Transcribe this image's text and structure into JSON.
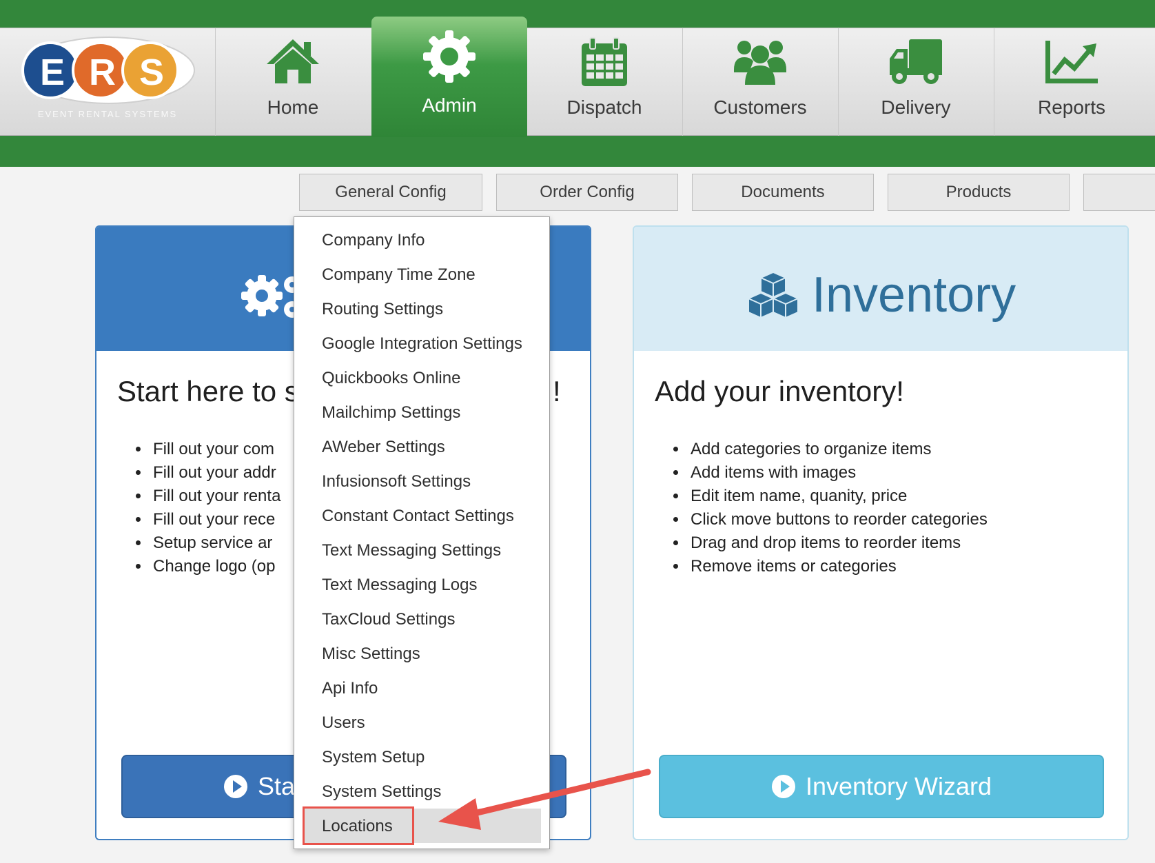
{
  "logo": {
    "letters": [
      "E",
      "R",
      "S"
    ],
    "tagline": "EVENT RENTAL SYSTEMS"
  },
  "nav": {
    "items": [
      {
        "label": "Home",
        "icon": "home-icon"
      },
      {
        "label": "Admin",
        "icon": "gear-icon",
        "active": true
      },
      {
        "label": "Dispatch",
        "icon": "calendar-icon"
      },
      {
        "label": "Customers",
        "icon": "users-icon"
      },
      {
        "label": "Delivery",
        "icon": "truck-icon"
      },
      {
        "label": "Reports",
        "icon": "line-chart-icon"
      }
    ]
  },
  "subtabs": [
    "General Config",
    "Order Config",
    "Documents",
    "Products",
    ""
  ],
  "dropdown": {
    "items": [
      "Company Info",
      "Company Time Zone",
      "Routing Settings",
      "Google Integration Settings",
      "Quickbooks Online",
      "Mailchimp Settings",
      "AWeber Settings",
      "Infusionsoft Settings",
      "Constant Contact Settings",
      "Text Messaging Settings",
      "Text Messaging Logs",
      "TaxCloud Settings",
      "Misc Settings",
      "Api Info",
      "Users",
      "System Setup",
      "System Settings",
      "Locations"
    ],
    "highlighted": "Locations"
  },
  "setup_card": {
    "title": "Start here to s",
    "title_end": "!",
    "bullets": [
      "Fill out your com",
      "Fill out your addr",
      "Fill out your renta",
      "Fill out your rece",
      "Setup service ar",
      "Change logo (op"
    ],
    "button_label": "Sta"
  },
  "inventory_card": {
    "header_title": "Inventory",
    "title": "Add your inventory!",
    "bullets": [
      "Add categories to organize items",
      "Add items with images",
      "Edit item name, quanity, price",
      "Click move buttons to reorder categories",
      "Drag and drop items to reorder items",
      "Remove items or categories"
    ],
    "button_label": "Inventory Wizard"
  },
  "colors": {
    "brand_green": "#33873b",
    "setup_blue": "#3a7bbf",
    "inventory_light": "#d8ebf5",
    "inventory_button": "#5bc0df",
    "annotation_red": "#e8534b"
  }
}
